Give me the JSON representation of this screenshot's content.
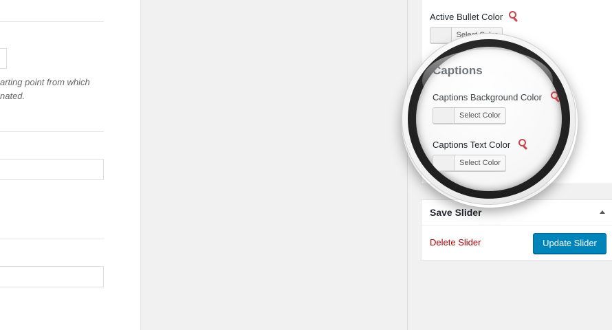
{
  "main": {
    "description": "arting point from which\nnated."
  },
  "sidebar": {
    "active_bullet": {
      "label": "Active Bullet Color",
      "button_label": "Select Color"
    },
    "captions": {
      "heading": "Captions",
      "background_color": {
        "label": "Captions Background Color",
        "button_label": "Select Color"
      },
      "text_color": {
        "label": "Captions Text Color",
        "button_label": "Select Color"
      }
    },
    "save": {
      "title": "Save Slider",
      "delete_label": "Delete Slider",
      "update_label": "Update Slider"
    }
  },
  "icons": {
    "help": "magnifier-icon",
    "toggle": "triangle-up-icon"
  },
  "colors": {
    "primary_button": "#0085ba",
    "delete_link": "#a00000",
    "help_icon": "#c9474b"
  }
}
